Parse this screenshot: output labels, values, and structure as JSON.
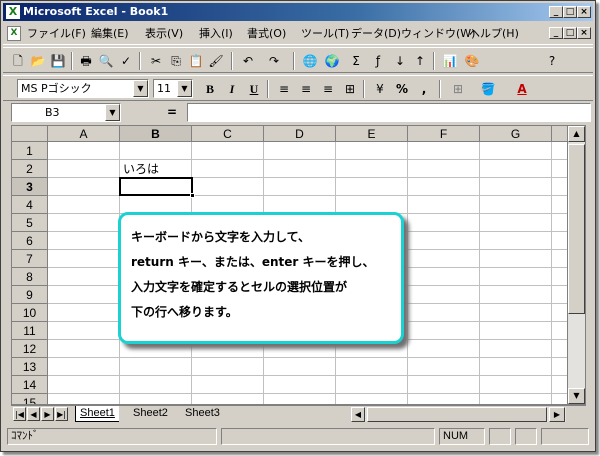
{
  "window": {
    "title": "Microsoft Excel - Book1",
    "logo": "X"
  },
  "menubar": {
    "items": [
      "ファイル(F)",
      "編集(E)",
      "表示(V)",
      "挿入(I)",
      "書式(O)",
      "ツール(T)",
      "データ(D)",
      "ウィンドウ(W)",
      "ヘルプ(H)"
    ]
  },
  "toolbar2": {
    "font": "MS Pゴシック",
    "size": "11",
    "bold": "B",
    "italic": "I",
    "underline": "U",
    "percent": "%",
    "comma": ","
  },
  "formula_bar": {
    "name_box": "B3",
    "equals": "=",
    "content": ""
  },
  "grid": {
    "columns": [
      "A",
      "B",
      "C",
      "D",
      "E",
      "F",
      "G"
    ],
    "rows": [
      "1",
      "2",
      "3",
      "4",
      "5",
      "6",
      "7",
      "8",
      "9",
      "10",
      "11",
      "12",
      "13",
      "14",
      "15"
    ],
    "active_column": "B",
    "active_row": "3",
    "cells": {
      "B2": "いろは"
    }
  },
  "sheets": {
    "tabs": [
      "Sheet1",
      "Sheet2",
      "Sheet3"
    ],
    "active": "Sheet1"
  },
  "status": {
    "mode": "ｺﾏﾝﾄﾞ",
    "num": "NUM"
  },
  "callout": {
    "lines": [
      "キーボードから文字を入力して、",
      "return キー、または、enter キーを押し、",
      "入力文字を確定するとセルの選択位置が",
      "下の行へ移ります。"
    ]
  },
  "colors": {
    "callout_border": "#1ad2d2",
    "titlebar": "#0a246a"
  }
}
